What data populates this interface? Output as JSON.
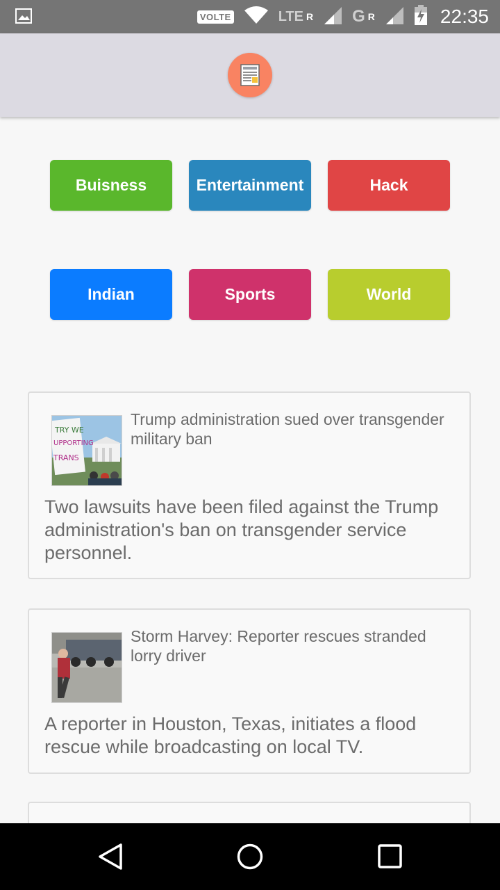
{
  "status_bar": {
    "network_badge": "VOLTE",
    "lte_label": "LTE",
    "roaming1": "R",
    "g_label": "G",
    "roaming2": "R",
    "time": "22:35",
    "icons": [
      "image-icon",
      "wifi-icon",
      "signal-icon",
      "battery-charging-icon"
    ]
  },
  "app_bar": {
    "logo_icon": "newspaper-icon",
    "logo_color": "#f98362"
  },
  "categories": [
    {
      "label": "Buisness",
      "color": "#5ab72c"
    },
    {
      "label": "Entertainment",
      "color": "#2a87bd"
    },
    {
      "label": "Hack",
      "color": "#e04545"
    },
    {
      "label": "Indian",
      "color": "#0b7cff"
    },
    {
      "label": "Sports",
      "color": "#cf326b"
    },
    {
      "label": "World",
      "color": "#b8cd2e"
    }
  ],
  "articles": [
    {
      "title": "Trump administration sued over transgender military ban",
      "description": "Two lawsuits have been filed against the Trump administration's ban on transgender service personnel."
    },
    {
      "title": "Storm Harvey: Reporter rescues stranded lorry driver",
      "description": "A reporter in Houston, Texas, initiates a flood rescue while broadcasting on local TV."
    }
  ],
  "nav_bar": {
    "icons": [
      "back-icon",
      "home-icon",
      "recents-icon"
    ]
  }
}
